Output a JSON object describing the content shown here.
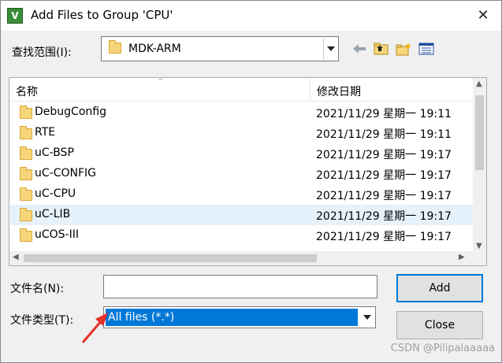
{
  "window": {
    "title": "Add Files to Group 'CPU'",
    "close_glyph": "✕",
    "app_icon_glyph": "V"
  },
  "lookin": {
    "label": "查找范围(I):",
    "value": "MDK-ARM"
  },
  "toolbar": [
    "back-arrow-icon",
    "up-folder-icon",
    "new-folder-icon",
    "view-menu-icon"
  ],
  "list": {
    "header_name": "名称",
    "header_date": "修改日期",
    "rows": [
      {
        "name": "DebugConfig",
        "date": "2021/11/29 星期一 19:11"
      },
      {
        "name": "RTE",
        "date": "2021/11/29 星期一 19:11"
      },
      {
        "name": "uC-BSP",
        "date": "2021/11/29 星期一 19:17"
      },
      {
        "name": "uC-CONFIG",
        "date": "2021/11/29 星期一 19:17"
      },
      {
        "name": "uC-CPU",
        "date": "2021/11/29 星期一 19:17"
      },
      {
        "name": "uC-LIB",
        "date": "2021/11/29 星期一 19:17",
        "selected": true
      },
      {
        "name": "uCOS-III",
        "date": "2021/11/29 星期一 19:17"
      }
    ]
  },
  "form": {
    "filename_label": "文件名(N):",
    "filename_value": "",
    "filetype_label": "文件类型(T):",
    "filetype_value": "All files (*.*)"
  },
  "buttons": {
    "add": "Add",
    "close": "Close"
  },
  "watermark": "CSDN @Pilipalaaaaa",
  "colors": {
    "selection": "#0078d7",
    "row_highlight": "#e5f1fb",
    "annotation_arrow": "#e8302a"
  }
}
